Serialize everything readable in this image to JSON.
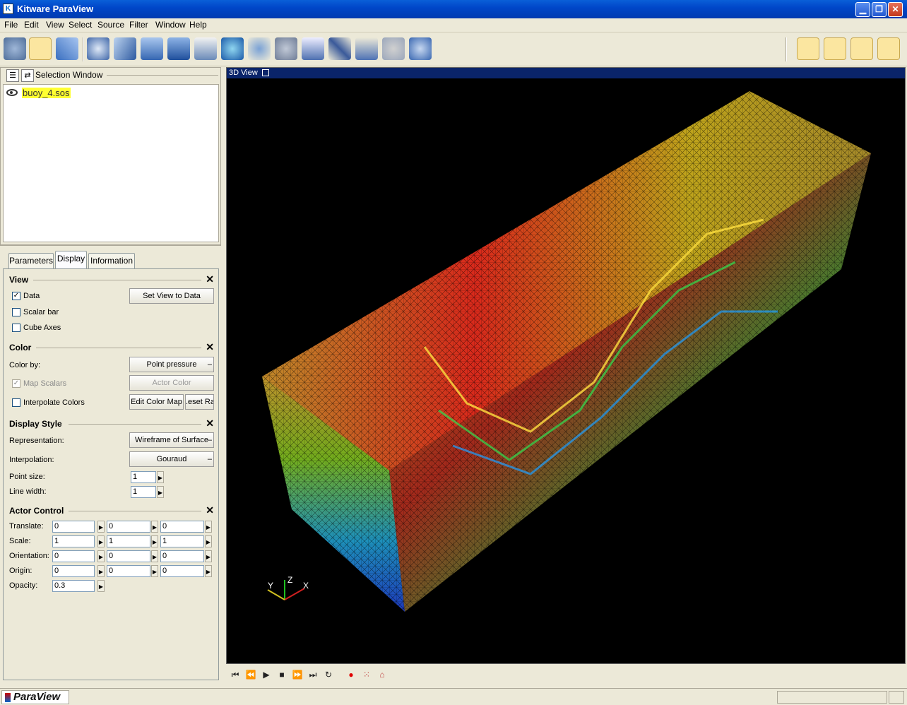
{
  "window": {
    "title": "Kitware ParaView",
    "app_icon": "kitware-icon",
    "minimize": "▁",
    "restore": "❐",
    "close": "✕"
  },
  "menu": [
    "File",
    "Edit",
    "View",
    "Select",
    "Source",
    "Filter",
    "Window",
    "Help"
  ],
  "toolbar_icons": [
    "pick-center-icon",
    "reset-camera-icon",
    "axes-icon",
    "calculator-icon",
    "contour-icon",
    "clip-icon",
    "cut-icon",
    "threshold-icon",
    "extract-grid-icon",
    "glyph-icon",
    "stream-tracer-icon",
    "warp-icon",
    "plot-icon",
    "probe-icon",
    "stream-line-icon",
    "ribbon-icon",
    "measure-icon"
  ],
  "camera_icons": [
    "undo-camera-icon",
    "redo-camera-icon",
    "reset-view-icon",
    "custom-camera-icon"
  ],
  "selection_window": {
    "title": "Selection Window",
    "item": "buoy_4.sos"
  },
  "tabs": [
    "Parameters",
    "Display",
    "Information"
  ],
  "active_tab": "Display",
  "view_group": {
    "title": "View",
    "data_label": "Data",
    "data_checked": "✓",
    "scalar_bar_label": "Scalar bar",
    "cube_axes_label": "Cube Axes",
    "set_view_button": "Set View to Data"
  },
  "color_group": {
    "title": "Color",
    "color_by_label": "Color by:",
    "color_by_value": "Point pressure",
    "map_scalars_label": "Map Scalars",
    "map_scalars_checked": "✓",
    "actor_color_button": "Actor Color",
    "interpolate_label": "Interpolate Colors",
    "edit_color_map_button": "Edit Color Map",
    "reset_range_button": ".eset Ra"
  },
  "display_style_group": {
    "title": "Display Style",
    "representation_label": "Representation:",
    "representation_value": "Wireframe of Surface",
    "interpolation_label": "Interpolation:",
    "interpolation_value": "Gouraud",
    "point_size_label": "Point size:",
    "point_size_value": "1",
    "line_width_label": "Line width:",
    "line_width_value": "1"
  },
  "actor_control_group": {
    "title": "Actor Control",
    "translate_label": "Translate:",
    "translate": [
      "0",
      "0",
      "0"
    ],
    "scale_label": "Scale:",
    "scale": [
      "1",
      "1",
      "1"
    ],
    "orientation_label": "Orientation:",
    "orientation": [
      "0",
      "0",
      "0"
    ],
    "origin_label": "Origin:",
    "origin": [
      "0",
      "0",
      "0"
    ],
    "opacity_label": "Opacity:",
    "opacity": "0.3"
  },
  "view3d": {
    "title": "3D View",
    "axes": {
      "x": "X",
      "y": "Y",
      "z": "Z"
    }
  },
  "animation_controls": [
    "first-frame-icon",
    "previous-frame-icon",
    "play-icon",
    "stop-icon",
    "next-frame-icon",
    "last-frame-icon",
    "loop-icon",
    "record-icon",
    "keyframe-icon",
    "camera-track-icon"
  ],
  "status": {
    "logo": "ParaView"
  },
  "colors": {
    "title_bar": "#0047c9",
    "background": "#ece9d8",
    "view_bg": "#000000",
    "highlight": "#ffff33"
  }
}
